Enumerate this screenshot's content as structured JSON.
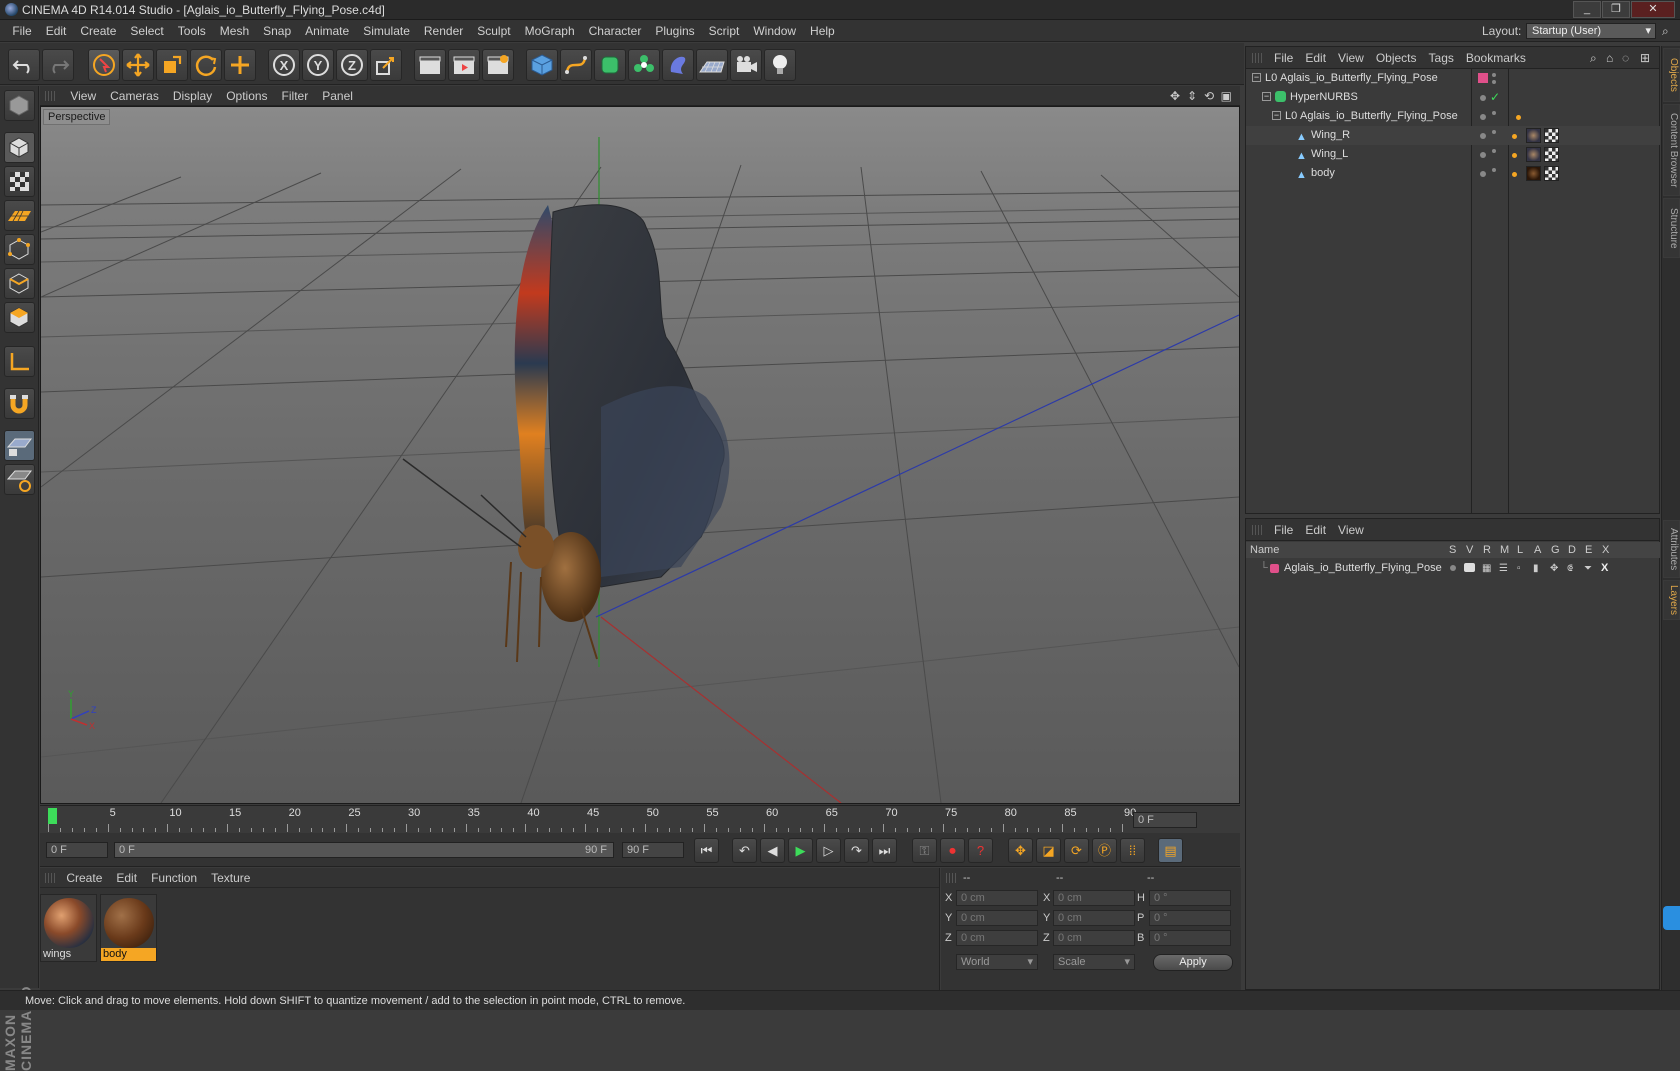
{
  "window": {
    "title": "CINEMA 4D R14.014 Studio - [Aglais_io_Butterfly_Flying_Pose.c4d]"
  },
  "menubar": {
    "items": [
      "File",
      "Edit",
      "Create",
      "Select",
      "Tools",
      "Mesh",
      "Snap",
      "Animate",
      "Simulate",
      "Render",
      "Sculpt",
      "MoGraph",
      "Character",
      "Plugins",
      "Script",
      "Window",
      "Help"
    ],
    "layout_label": "Layout:",
    "layout_value": "Startup (User)"
  },
  "viewport": {
    "menu": [
      "View",
      "Cameras",
      "Display",
      "Options",
      "Filter",
      "Panel"
    ],
    "label": "Perspective"
  },
  "timeline": {
    "ticks": [
      "0",
      "5",
      "10",
      "15",
      "20",
      "25",
      "30",
      "35",
      "40",
      "45",
      "50",
      "55",
      "60",
      "65",
      "70",
      "75",
      "80",
      "85",
      "90"
    ],
    "current_frame": "0 F"
  },
  "transport": {
    "start_field": "0 F",
    "range_start": "0 F",
    "range_end": "90 F",
    "end_field": "90 F"
  },
  "materials": {
    "menu": [
      "Create",
      "Edit",
      "Function",
      "Texture"
    ],
    "items": [
      {
        "name": "wings",
        "selected": false
      },
      {
        "name": "body",
        "selected": true
      }
    ]
  },
  "coords": {
    "headers": [
      "--",
      "--",
      "--"
    ],
    "rows": [
      {
        "a": "X",
        "av": "0 cm",
        "b": "X",
        "bv": "0 cm",
        "c": "H",
        "cv": "0 °"
      },
      {
        "a": "Y",
        "av": "0 cm",
        "b": "Y",
        "bv": "0 cm",
        "c": "P",
        "cv": "0 °"
      },
      {
        "a": "Z",
        "av": "0 cm",
        "b": "Z",
        "bv": "0 cm",
        "c": "B",
        "cv": "0 °"
      }
    ],
    "mode1": "World",
    "mode2": "Scale",
    "apply": "Apply"
  },
  "objects": {
    "menu": [
      "File",
      "Edit",
      "View",
      "Objects",
      "Tags",
      "Bookmarks"
    ],
    "tree": [
      {
        "name": "Aglais_io_Butterfly_Flying_Pose",
        "depth": 0
      },
      {
        "name": "HyperNURBS",
        "depth": 1
      },
      {
        "name": "Aglais_io_Butterfly_Flying_Pose",
        "depth": 2
      },
      {
        "name": "Wing_R",
        "depth": 3
      },
      {
        "name": "Wing_L",
        "depth": 3
      },
      {
        "name": "body",
        "depth": 3
      }
    ]
  },
  "layers": {
    "menu": [
      "File",
      "Edit",
      "View"
    ],
    "header_name": "Name",
    "columns": [
      "S",
      "V",
      "R",
      "M",
      "L",
      "A",
      "G",
      "D",
      "E",
      "X"
    ],
    "rows": [
      {
        "name": "Aglais_io_Butterfly_Flying_Pose",
        "color": "#e0508a"
      }
    ]
  },
  "side_tabs": [
    "Objects",
    "Content Browser",
    "Structure",
    "Attributes",
    "Layers"
  ],
  "status": "Move: Click and drag to move elements. Hold down SHIFT to quantize movement / add to the selection in point mode, CTRL to remove.",
  "brand": "MAXON CINEMA 4D",
  "colors": {
    "accent": "#f5a623",
    "axis_x": "#c03030",
    "axis_y": "#30a030",
    "axis_z": "#3040c0"
  }
}
